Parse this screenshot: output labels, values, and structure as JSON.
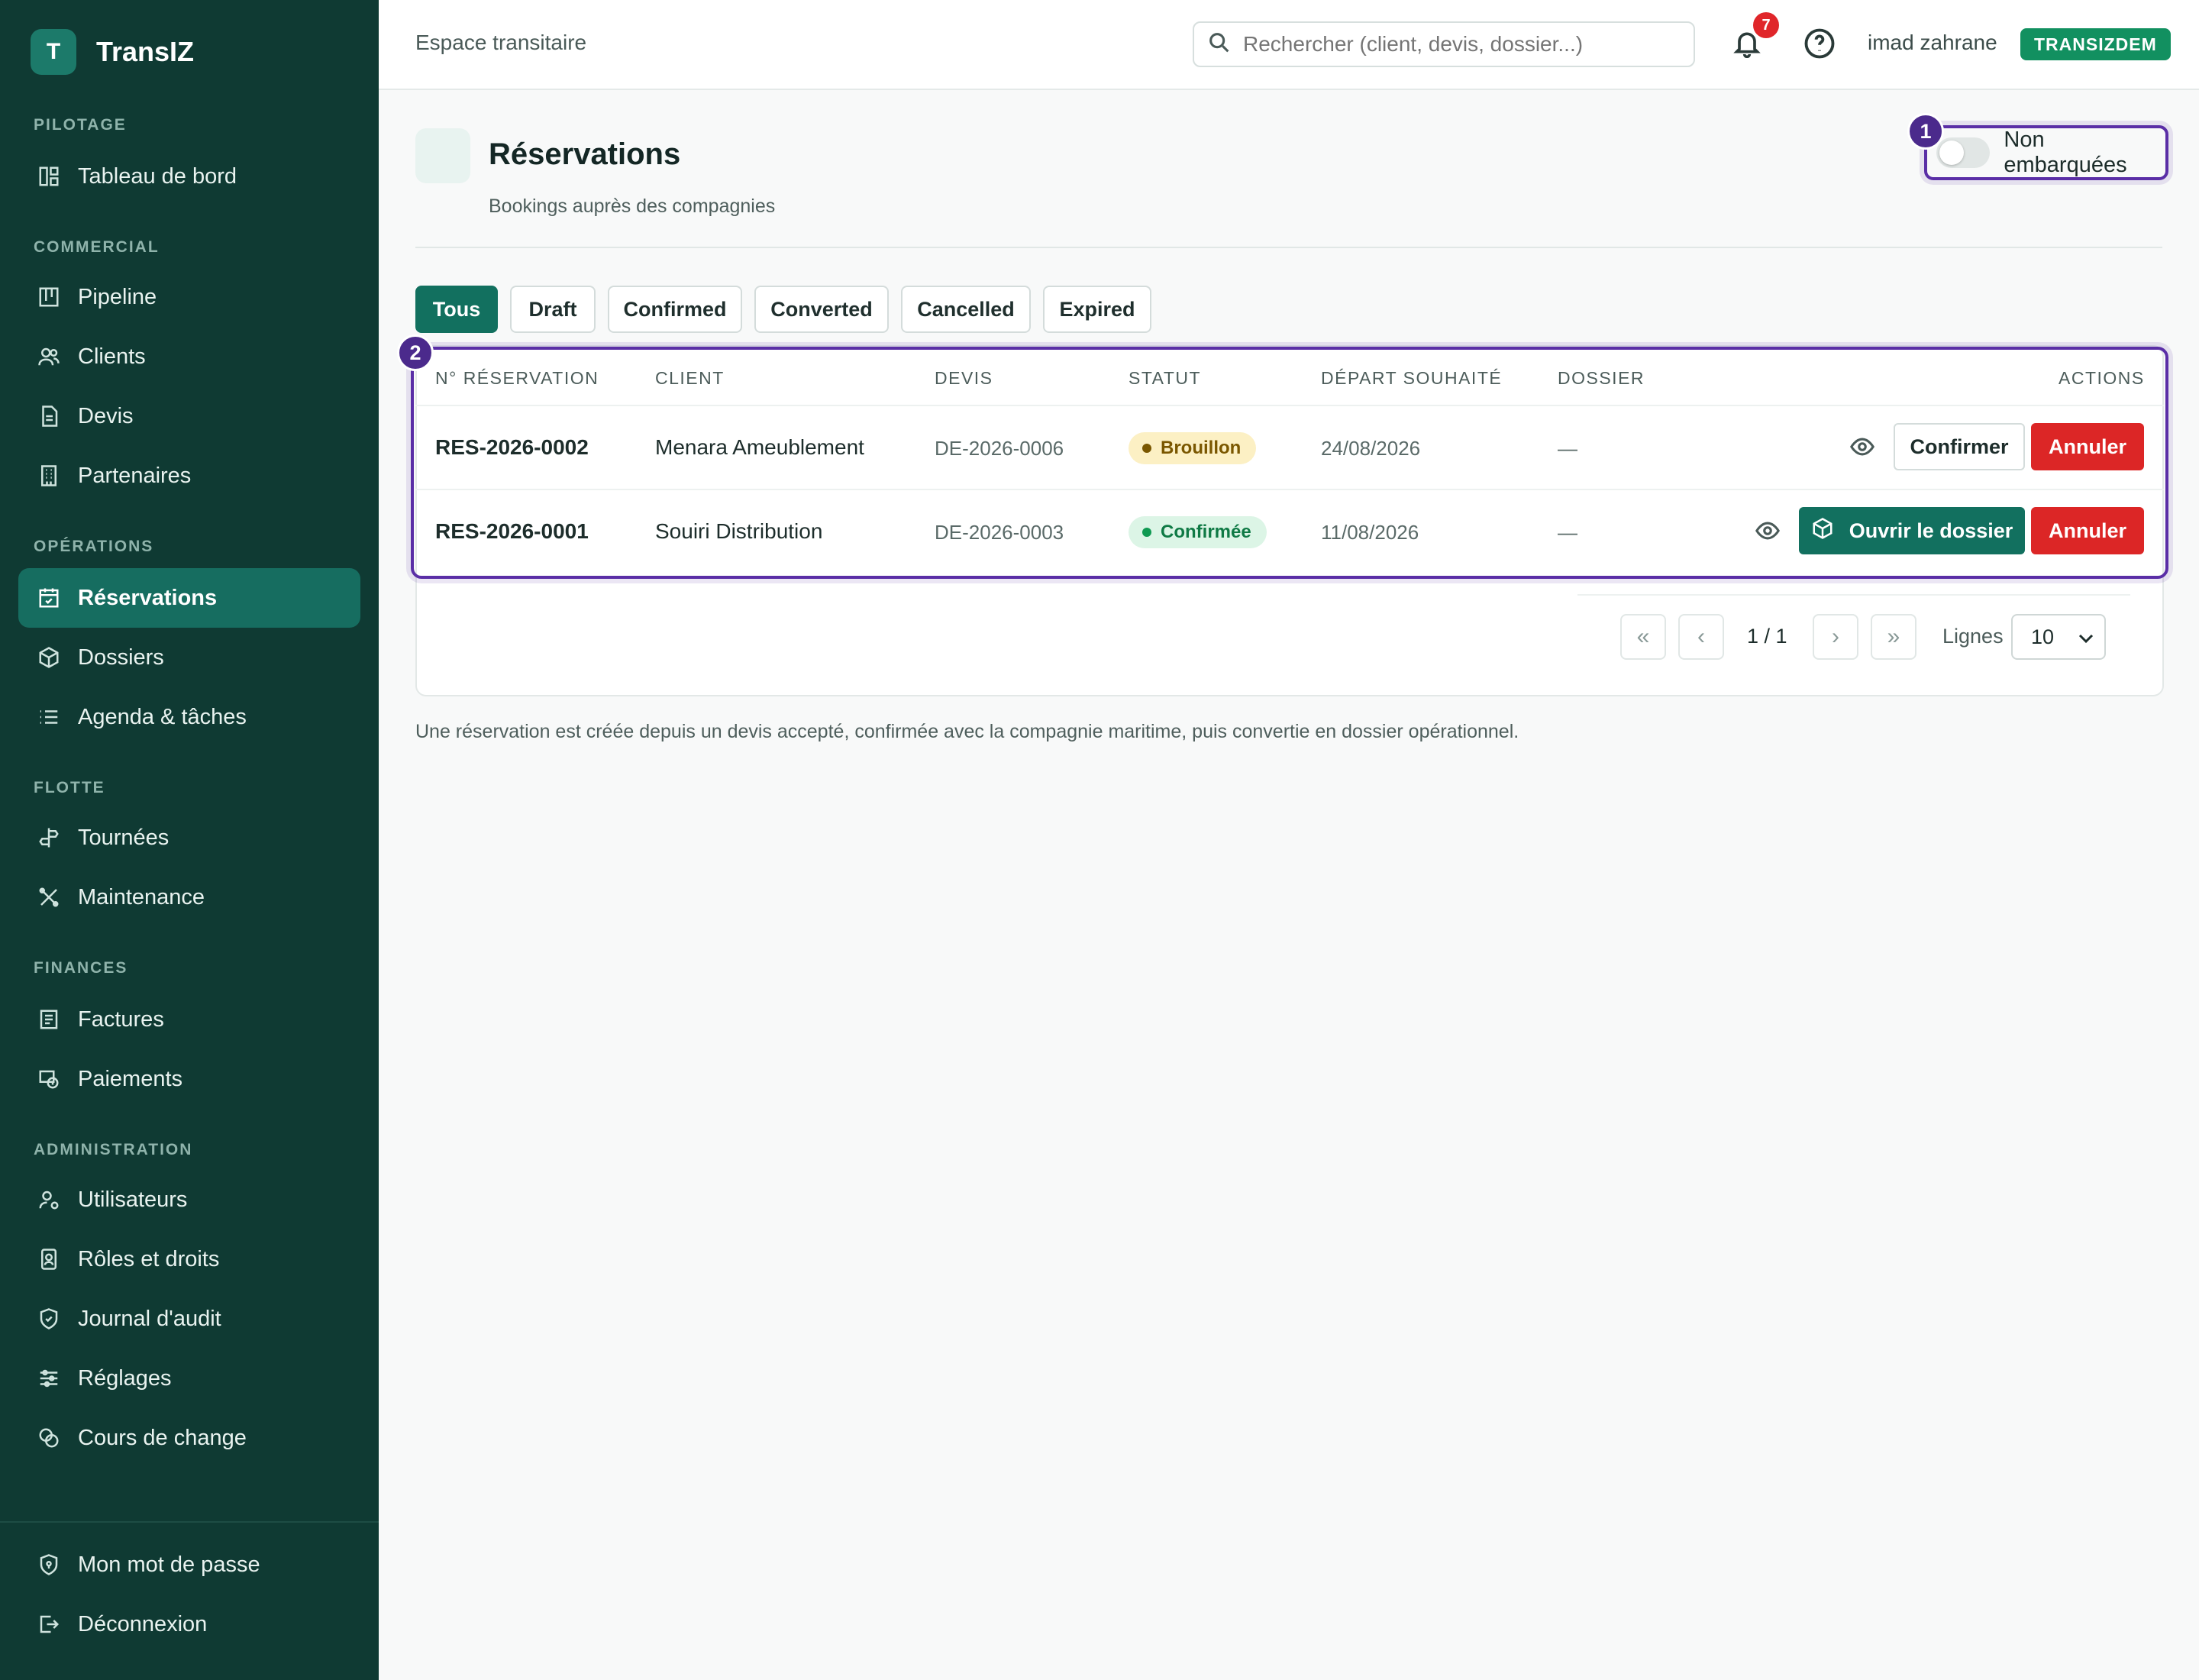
{
  "brand": {
    "logo_letter": "T",
    "name": "TransIZ"
  },
  "sidebar": {
    "sections": [
      {
        "title": "PILOTAGE",
        "items": [
          {
            "label": "Tableau de bord",
            "icon": "dashboard-icon"
          }
        ]
      },
      {
        "title": "COMMERCIAL",
        "items": [
          {
            "label": "Pipeline",
            "icon": "kanban-icon"
          },
          {
            "label": "Clients",
            "icon": "users-icon"
          },
          {
            "label": "Devis",
            "icon": "document-icon"
          },
          {
            "label": "Partenaires",
            "icon": "building-icon"
          }
        ]
      },
      {
        "title": "OPÉRATIONS",
        "items": [
          {
            "label": "Réservations",
            "icon": "calendar-check-icon",
            "active": true
          },
          {
            "label": "Dossiers",
            "icon": "package-icon"
          },
          {
            "label": "Agenda & tâches",
            "icon": "list-icon"
          }
        ]
      },
      {
        "title": "FLOTTE",
        "items": [
          {
            "label": "Tournées",
            "icon": "signpost-icon"
          },
          {
            "label": "Maintenance",
            "icon": "tools-icon"
          }
        ]
      },
      {
        "title": "FINANCES",
        "items": [
          {
            "label": "Factures",
            "icon": "invoice-icon"
          },
          {
            "label": "Paiements",
            "icon": "payment-icon"
          }
        ]
      },
      {
        "title": "ADMINISTRATION",
        "items": [
          {
            "label": "Utilisateurs",
            "icon": "user-cog-icon"
          },
          {
            "label": "Rôles et droits",
            "icon": "badge-icon"
          },
          {
            "label": "Journal d'audit",
            "icon": "shield-check-icon"
          },
          {
            "label": "Réglages",
            "icon": "sliders-icon"
          },
          {
            "label": "Cours de change",
            "icon": "coins-icon"
          }
        ]
      }
    ],
    "footer": [
      {
        "label": "Mon mot de passe",
        "icon": "shield-key-icon"
      },
      {
        "label": "Déconnexion",
        "icon": "logout-icon"
      }
    ]
  },
  "topbar": {
    "title": "Espace transitaire",
    "search_placeholder": "Rechercher (client, devis, dossier...)",
    "notification_count": "7",
    "user_name": "imad zahrane",
    "tenant": "TRANSIZDEM"
  },
  "page": {
    "title": "Réservations",
    "subtitle": "Bookings auprès des compagnies",
    "toggle_label": "Non embarquées",
    "toggle_on": false,
    "footnote": "Une réservation est créée depuis un devis accepté, confirmée avec la compagnie maritime, puis convertie en dossier opérationnel."
  },
  "markers": {
    "one": "1",
    "two": "2"
  },
  "filters": [
    "Tous",
    "Draft",
    "Confirmed",
    "Converted",
    "Cancelled",
    "Expired"
  ],
  "active_filter": "Tous",
  "table": {
    "columns": {
      "number": "N° RÉSERVATION",
      "client": "CLIENT",
      "quote": "DEVIS",
      "status": "STATUT",
      "departure": "DÉPART SOUHAITÉ",
      "file": "DOSSIER",
      "actions": "ACTIONS"
    },
    "rows": [
      {
        "number": "RES-2026-0002",
        "client": "Menara Ameublement",
        "quote": "DE-2026-0006",
        "status": "Brouillon",
        "departure": "24/08/2026",
        "file": "—",
        "primary_action": "Confirmer",
        "cancel_action": "Annuler"
      },
      {
        "number": "RES-2026-0001",
        "client": "Souiri Distribution",
        "quote": "DE-2026-0003",
        "status": "Confirmée",
        "departure": "11/08/2026",
        "file": "—",
        "primary_action": "Ouvrir le dossier",
        "cancel_action": "Annuler"
      }
    ]
  },
  "pagination": {
    "first": "«",
    "prev": "‹",
    "next": "›",
    "last": "»",
    "info": "1 / 1",
    "rows_label": "Lignes",
    "rows_value": "10"
  },
  "colors": {
    "sidebar_bg": "#0f3a33",
    "accent": "#12705f",
    "danger": "#dc2626",
    "highlight": "#5a2ea6",
    "tenant_badge": "#129060"
  }
}
